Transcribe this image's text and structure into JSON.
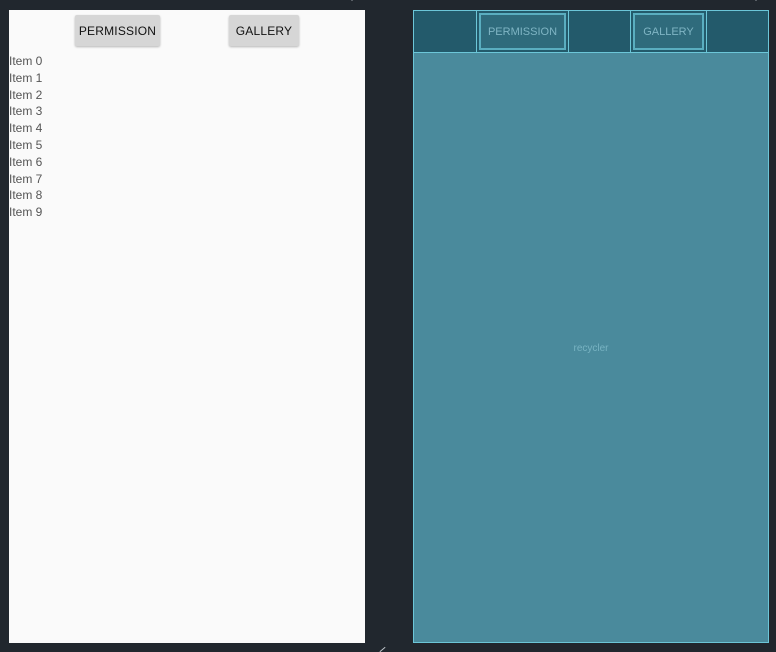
{
  "design_preview": {
    "buttons": {
      "permission": "PERMISSION",
      "gallery": "GALLERY"
    },
    "items": [
      "Item 0",
      "Item 1",
      "Item 2",
      "Item 3",
      "Item 4",
      "Item 5",
      "Item 6",
      "Item 7",
      "Item 8",
      "Item 9"
    ]
  },
  "blueprint_preview": {
    "buttons": {
      "permission": "PERMISSION",
      "gallery": "GALLERY"
    },
    "recycler_label": "recycler"
  },
  "colors": {
    "canvas_background": "#21272e",
    "design_background": "#fafafa",
    "button_background": "#d6d6d6",
    "blueprint_background": "#4a8a9c",
    "blueprint_toolbar": "#235a6b",
    "blueprint_outline": "#6cc6d8"
  },
  "icons": {
    "corner_markers": "triangle-marker-icon",
    "resize_handle": "resize-handle-icon"
  }
}
